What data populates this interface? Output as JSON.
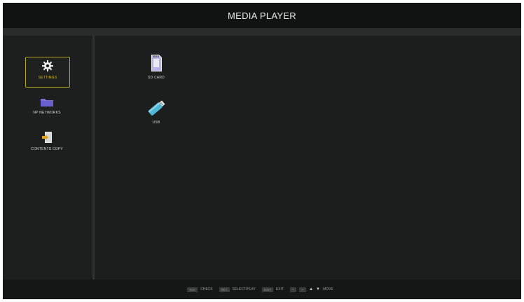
{
  "title": "MEDIA PLAYER",
  "sidebar": {
    "items": [
      {
        "label": "SETTINGS",
        "icon": "gear-icon",
        "selected": true
      },
      {
        "label": "NP NETWORKS",
        "icon": "folder-icon",
        "selected": false
      },
      {
        "label": "CONTENTS COPY",
        "icon": "copy-icon",
        "selected": false
      }
    ]
  },
  "main": {
    "items": [
      {
        "label": "SD CARD",
        "icon": "sd-card-icon"
      },
      {
        "label": "USB",
        "icon": "usb-icon"
      }
    ]
  },
  "footer": {
    "ent_key": "ENT",
    "ent_hint": "CHECK",
    "set_key": "SET",
    "set_hint": "SELECT/PLAY",
    "exit_key": "EXIT",
    "exit_hint": "EXIT",
    "plus": "+",
    "minus": "—",
    "up": "▲",
    "down": "▼",
    "move_hint": "MOVE"
  },
  "colors": {
    "background": "#1b1c1c",
    "selected_border": "#b0a21a",
    "selected_text": "#d8c41a",
    "folder": "#7b6fd8",
    "usb": "#4fb6d6"
  }
}
